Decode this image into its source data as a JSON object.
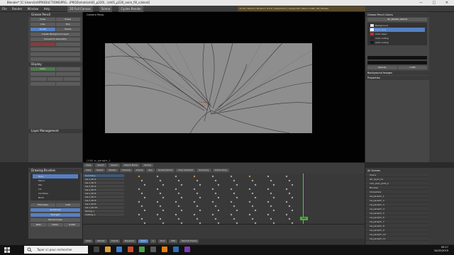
{
  "window": {
    "title": "Blender* [C:\\Users\\lrd\\PRODUCTIONS\\PRG...\\PROD\\shots\\sh01_p220\\...\\sh01_p220_anim_fill_v.blend]",
    "controls": "— □ ✕"
  },
  "menubar": {
    "items": [
      "File",
      "Render",
      "Window",
      "Help"
    ],
    "layout": "2D Full Canvas",
    "scene": "Scene",
    "engine": "Cycles Render",
    "stats": "v2.79 | Verts:0 | Faces:0 | Tris:0 | Objects:0/1 | Lamps:0/0 | Mem:1.10M | GP_Strokes"
  },
  "tool_panel": {
    "header": "Grease Pencil",
    "draw_label": "Draw",
    "erase_label": "Erase",
    "line_label": "Line",
    "poly_label": "Poly",
    "sculpt_label": "Sculpt",
    "stroke_label": "Stroke",
    "create_bg_label": "Create Background Layer",
    "convert_label": "Convert to Geometry",
    "display_header": "Display",
    "color_label": "Color",
    "layer_management": "Layer Management"
  },
  "viewport": {
    "label": "Camera Persp",
    "frame_label": "(100) sc_paraphr_1",
    "header_buttons": [
      "View",
      "Select",
      "Object",
      "Object Mode",
      "Global"
    ]
  },
  "grease_pencil_colors": {
    "header": "Grease Pencil Colors",
    "palette": "GP_Palette_default",
    "layers": [
      {
        "name": "Background",
        "color": "#e0e0e0"
      },
      {
        "name": "Color Line",
        "color": "#ffffff",
        "selected": true
      },
      {
        "name": "Color layer",
        "color": "#c03030"
      },
      {
        "name": "anim coding",
        "color": "#2a2a2a"
      },
      {
        "name": "anim coding",
        "color": "#1a1a1a"
      }
    ],
    "opacity_label": "Opacity",
    "opacity_value": "1.000",
    "background_images": "Background Images",
    "properties": "Properties"
  },
  "dopesheet": {
    "header_buttons": [
      "View",
      "Select",
      "Marker",
      "Channel",
      "Frame",
      "Key",
      "Grease Pencil",
      "Only Selected",
      "Summary",
      "Active Only"
    ],
    "channels": [
      "Summary",
      "sw-1_Str.2",
      "sw-1_Str.3",
      "sw-1_Str.4",
      "sw-1_Str.5",
      "sw-1_Str.6",
      "sw-1_Str.7",
      "sw-1_Str.8",
      "sw-1_Str.9",
      "sw-1_Str.10",
      "Spring_1",
      "Casting_1"
    ],
    "current_frame": "106",
    "timeline_buttons": [
      "View",
      "Marker",
      "Frame",
      "Playback",
      "Start",
      "End",
      "Normal Frame"
    ],
    "start": "1",
    "end": "256"
  },
  "drawing_brushes": {
    "header": "Drawing Brushes",
    "items": [
      "Basic",
      "Pencil",
      "Pen",
      "Ink",
      "Ink Noise",
      "Block"
    ],
    "thickness_label": "Thickness",
    "thickness_value": "3.00",
    "sensitivity_label": "Sensitivity",
    "strength_label": "Strength",
    "randomness_label": "Randomness",
    "jitter_label": "Jitter",
    "factor_label": "Factor",
    "factor_value": "0.000"
  },
  "outliner": {
    "header": "All Scenes",
    "items": [
      "Scene",
      "GP_Layer_01",
      "cam_shot_p220_a",
      "Brushes",
      "Characters",
      "sw_paraphr_1",
      "sw_paraphr_2",
      "sw_paraphr_3",
      "sw_paraphr_4",
      "sw_paraphr_5",
      "sw_paraphr_6",
      "sw_paraphr_7",
      "sw_paraphr_8",
      "sw_paraphr_9",
      "sw_paraphr_10",
      "sw_paraphr_11"
    ]
  },
  "taskbar": {
    "search_placeholder": "Taper ici pour rechercher",
    "time": "09:17",
    "date": "20/02/2019"
  }
}
